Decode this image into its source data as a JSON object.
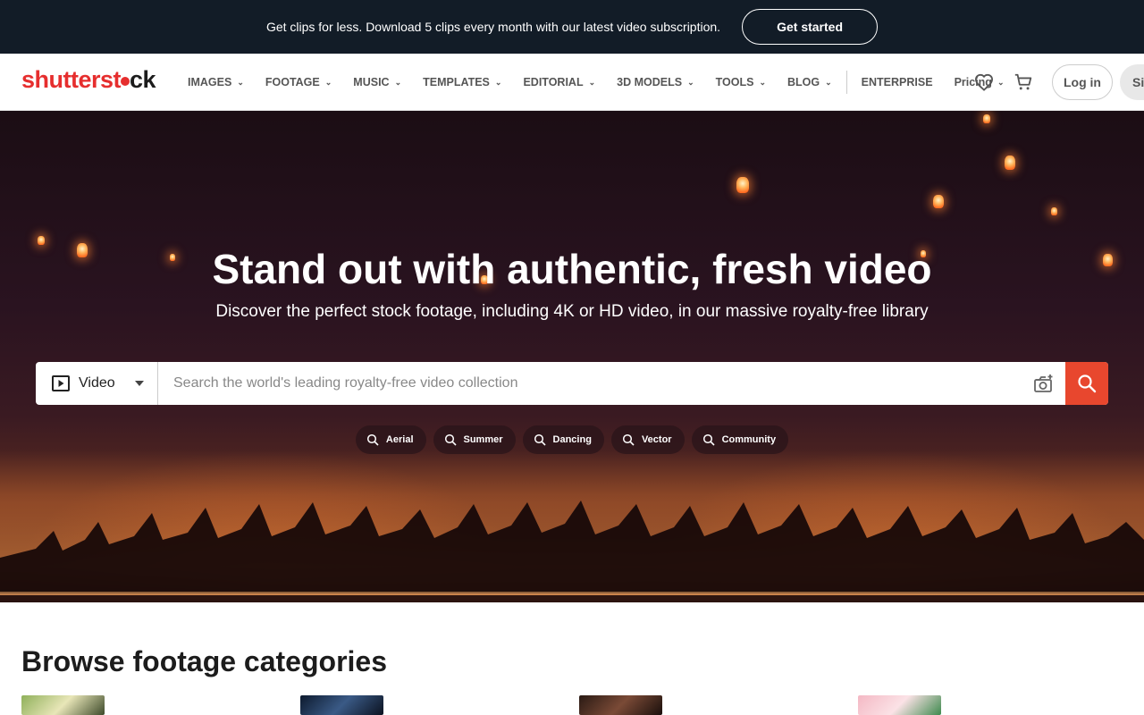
{
  "promo": {
    "text": "Get clips for less. Download 5 clips every month with our latest video subscription.",
    "button": "Get started"
  },
  "brand": {
    "part1": "shutterst",
    "part2": "ck"
  },
  "nav": {
    "items": [
      {
        "label": "IMAGES"
      },
      {
        "label": "FOOTAGE"
      },
      {
        "label": "MUSIC"
      },
      {
        "label": "TEMPLATES"
      },
      {
        "label": "EDITORIAL"
      },
      {
        "label": "3D MODELS"
      },
      {
        "label": "TOOLS"
      },
      {
        "label": "BLOG"
      }
    ],
    "enterprise": "ENTERPRISE",
    "pricing": "Pricing",
    "login": "Log in",
    "signup": "Si"
  },
  "hero": {
    "title": "Stand out with authentic, fresh video",
    "subtitle": "Discover the perfect stock footage, including 4K or HD video, in our massive royalty-free library"
  },
  "search": {
    "type": "Video",
    "placeholder": "Search the world's leading royalty-free video collection"
  },
  "chips": [
    "Aerial",
    "Summer",
    "Dancing",
    "Vector",
    "Community"
  ],
  "browse": {
    "title": "Browse footage categories"
  },
  "colors": {
    "accent": "#e8472e",
    "brand_red": "#e62e2e",
    "promo_bg": "#121c27"
  }
}
